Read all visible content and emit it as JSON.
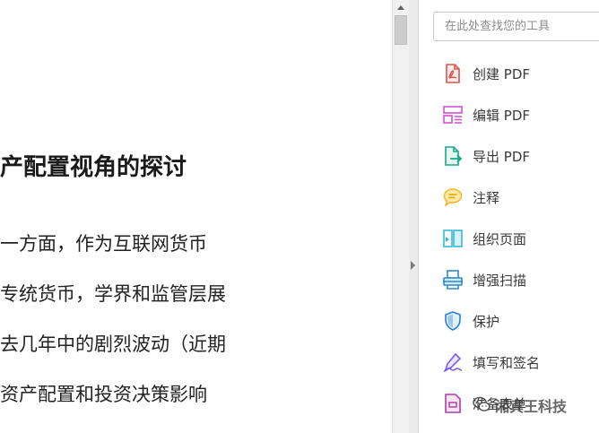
{
  "document": {
    "heading": "产配置视角的探讨",
    "lines": [
      "一方面，作为互联网货币",
      "专统货币，学界和监管层展",
      "去几年中的剧烈波动（近期",
      "资产配置和投资决策影响"
    ]
  },
  "tools_pane": {
    "search_placeholder": "在此处查找您的工具",
    "items": [
      {
        "label": "创建 PDF",
        "icon": "create-pdf-icon",
        "color": "#e0524a"
      },
      {
        "label": "编辑 PDF",
        "icon": "edit-pdf-icon",
        "color": "#d34fd3"
      },
      {
        "label": "导出 PDF",
        "icon": "export-pdf-icon",
        "color": "#1aa987"
      },
      {
        "label": "注释",
        "icon": "comment-icon",
        "color": "#f2b827"
      },
      {
        "label": "组织页面",
        "icon": "organize-pages-icon",
        "color": "#35b9d6"
      },
      {
        "label": "增强扫描",
        "icon": "enhance-scan-icon",
        "color": "#2c8ac9"
      },
      {
        "label": "保护",
        "icon": "protect-shield-icon",
        "color": "#2c7fd0"
      },
      {
        "label": "填写和签名",
        "icon": "fill-sign-icon",
        "color": "#7a5ce6"
      },
      {
        "label": "准备表单",
        "icon": "prepare-form-icon",
        "color": "#b03ca8"
      }
    ]
  },
  "watermark": {
    "text": "湘宾王科技",
    "icon": "wechat-logo-icon"
  }
}
